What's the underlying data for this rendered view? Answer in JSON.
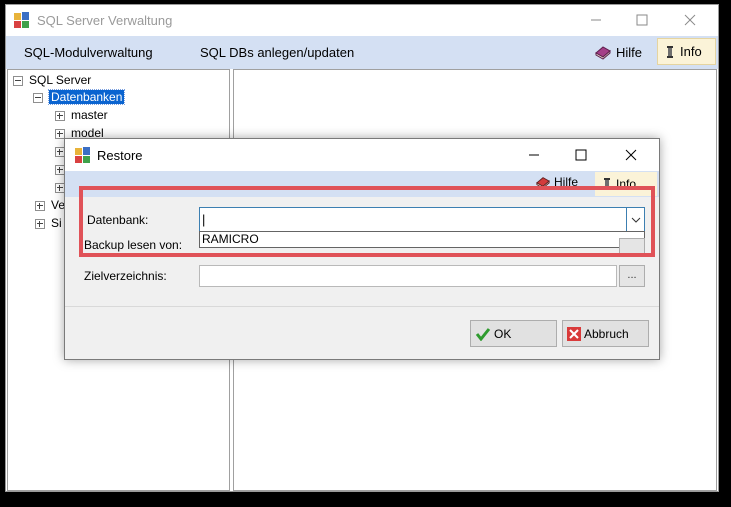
{
  "main_window": {
    "title": "SQL Server Verwaltung",
    "menu": [
      "SQL-Modulverwaltung",
      "SQL DBs anlegen/updaten"
    ],
    "hilfe_label": "Hilfe",
    "info_label": "Info"
  },
  "tree": {
    "root": "SQL Server",
    "databases_node": "Datenbanken",
    "databases": [
      "master",
      "model"
    ],
    "partial_nodes": [
      "Ve",
      "Si"
    ]
  },
  "dialog": {
    "title": "Restore",
    "hilfe_label": "Hilfe",
    "info_label": "Info",
    "datenbank_label": "Datenbank:",
    "datenbank_value": "|",
    "dropdown_option": "RAMICRO",
    "backup_label": "Backup lesen von:",
    "ziel_label": "Zielverzeichnis:",
    "browse_label": "...",
    "ok_label": "OK",
    "cancel_label": "Abbruch"
  }
}
